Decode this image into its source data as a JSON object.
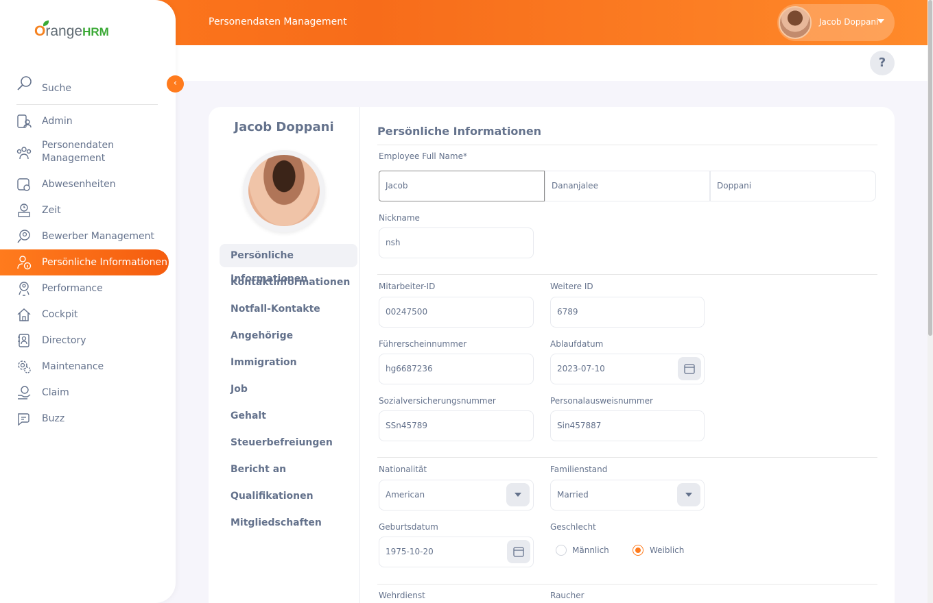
{
  "header": {
    "module_title": "Personendaten Management",
    "user_name": "Jacob Doppani",
    "help_label": "?"
  },
  "sidebar": {
    "logo_o": "O",
    "logo_range": "range",
    "logo_hrm": "HRM",
    "search_label": "Suche",
    "collapse_label": "‹",
    "items": [
      {
        "label": "Admin",
        "icon": "admin-icon"
      },
      {
        "label": "Personendaten Management",
        "icon": "pim-icon"
      },
      {
        "label": "Abwesenheiten",
        "icon": "leave-icon"
      },
      {
        "label": "Zeit",
        "icon": "time-icon"
      },
      {
        "label": "Bewerber Management",
        "icon": "recruitment-icon"
      },
      {
        "label": "Persönliche Informationen",
        "icon": "my-info-icon",
        "active": true
      },
      {
        "label": "Performance",
        "icon": "performance-icon"
      },
      {
        "label": "Cockpit",
        "icon": "dashboard-icon"
      },
      {
        "label": "Directory",
        "icon": "directory-icon"
      },
      {
        "label": "Maintenance",
        "icon": "maintenance-icon"
      },
      {
        "label": "Claim",
        "icon": "claim-icon"
      },
      {
        "label": "Buzz",
        "icon": "buzz-icon"
      }
    ]
  },
  "profile": {
    "name": "Jacob Doppani",
    "tabs": [
      "Persönliche Informationen",
      "Kontaktinformationen",
      "Notfall-Kontakte",
      "Angehörige",
      "Immigration",
      "Job",
      "Gehalt",
      "Steuerbefreiungen",
      "Bericht an",
      "Qualifikationen",
      "Mitgliedschaften"
    ]
  },
  "form": {
    "title": "Persönliche Informationen",
    "full_name_label": "Employee Full Name*",
    "first_name": "Jacob",
    "middle_name": "Dananjalee",
    "last_name": "Doppani",
    "nickname_label": "Nickname",
    "nickname": "nsh",
    "employee_id_label": "Mitarbeiter-ID",
    "employee_id": "00247500",
    "other_id_label": "Weitere ID",
    "other_id": "6789",
    "license_label": "Führerscheinnummer",
    "license": "hg6687236",
    "expiry_label": "Ablaufdatum",
    "expiry": "2023-07-10",
    "ssn_label": "Sozialversicherungsnummer",
    "ssn": "SSn45789",
    "sin_label": "Personalausweisnummer",
    "sin": "Sin457887",
    "nationality_label": "Nationalität",
    "nationality": "American",
    "marital_label": "Familienstand",
    "marital": "Married",
    "dob_label": "Geburtsdatum",
    "dob": "1975-10-20",
    "gender_label": "Geschlecht",
    "gender_male": "Männlich",
    "gender_female": "Weiblich",
    "gender_selected": "Weiblich",
    "military_label": "Wehrdienst",
    "smoker_label": "Raucher"
  },
  "colors": {
    "brand_orange": "#ff7b1d",
    "text": "#64728c"
  }
}
